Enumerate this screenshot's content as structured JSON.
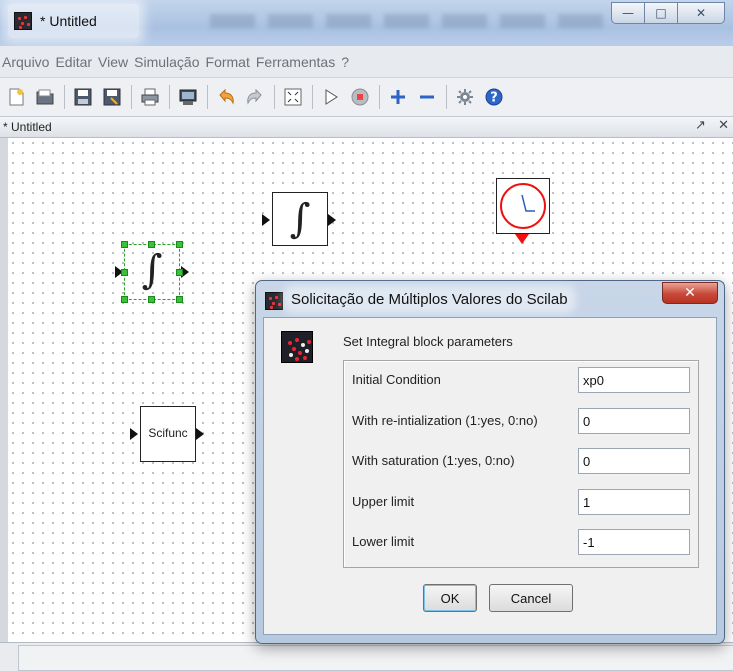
{
  "window": {
    "title": "* Untitled",
    "controls": {
      "minimize": "—",
      "maximize": "□",
      "close": "✕"
    }
  },
  "menu": [
    "Arquivo",
    "Editar",
    "View",
    "Simulação",
    "Format",
    "Ferramentas",
    "?"
  ],
  "toolbar": {
    "icons": [
      "new-diagram-icon",
      "open-icon",
      "save-icon",
      "save-as-icon",
      "print-icon",
      "export-icon",
      "undo-icon",
      "redo-icon",
      "fit-diagram-icon",
      "start-simulation-icon",
      "stop-simulation-icon",
      "zoom-in-icon",
      "zoom-out-icon",
      "palette-browser-icon",
      "help-icon"
    ]
  },
  "tab": {
    "title": "* Untitled",
    "controls": {
      "undock": "↗",
      "close": "✕"
    }
  },
  "diagram": {
    "blocks": [
      {
        "name": "integral-block",
        "label": "∫"
      },
      {
        "name": "integral-block-selected",
        "label": "∫",
        "selected": true
      },
      {
        "name": "clock-block",
        "label": ""
      },
      {
        "name": "scifunc-block",
        "label": "Scifunc"
      }
    ]
  },
  "dialog": {
    "title": "Solicitação de Múltiplos Valores do Scilab",
    "close_label": "✕",
    "heading": "Set Integral block parameters",
    "params": [
      {
        "label": "Initial Condition",
        "value": "xp0"
      },
      {
        "label": "With re-intialization (1:yes, 0:no)",
        "value": "0"
      },
      {
        "label": "With saturation (1:yes, 0:no)",
        "value": "0"
      },
      {
        "label": "Upper limit",
        "value": "1"
      },
      {
        "label": "Lower limit",
        "value": "-1"
      }
    ],
    "ok_label": "OK",
    "cancel_label": "Cancel"
  },
  "colors": {
    "clock": "#ee1111",
    "selection": "#39c139",
    "titlebar": "#b9cde8"
  }
}
